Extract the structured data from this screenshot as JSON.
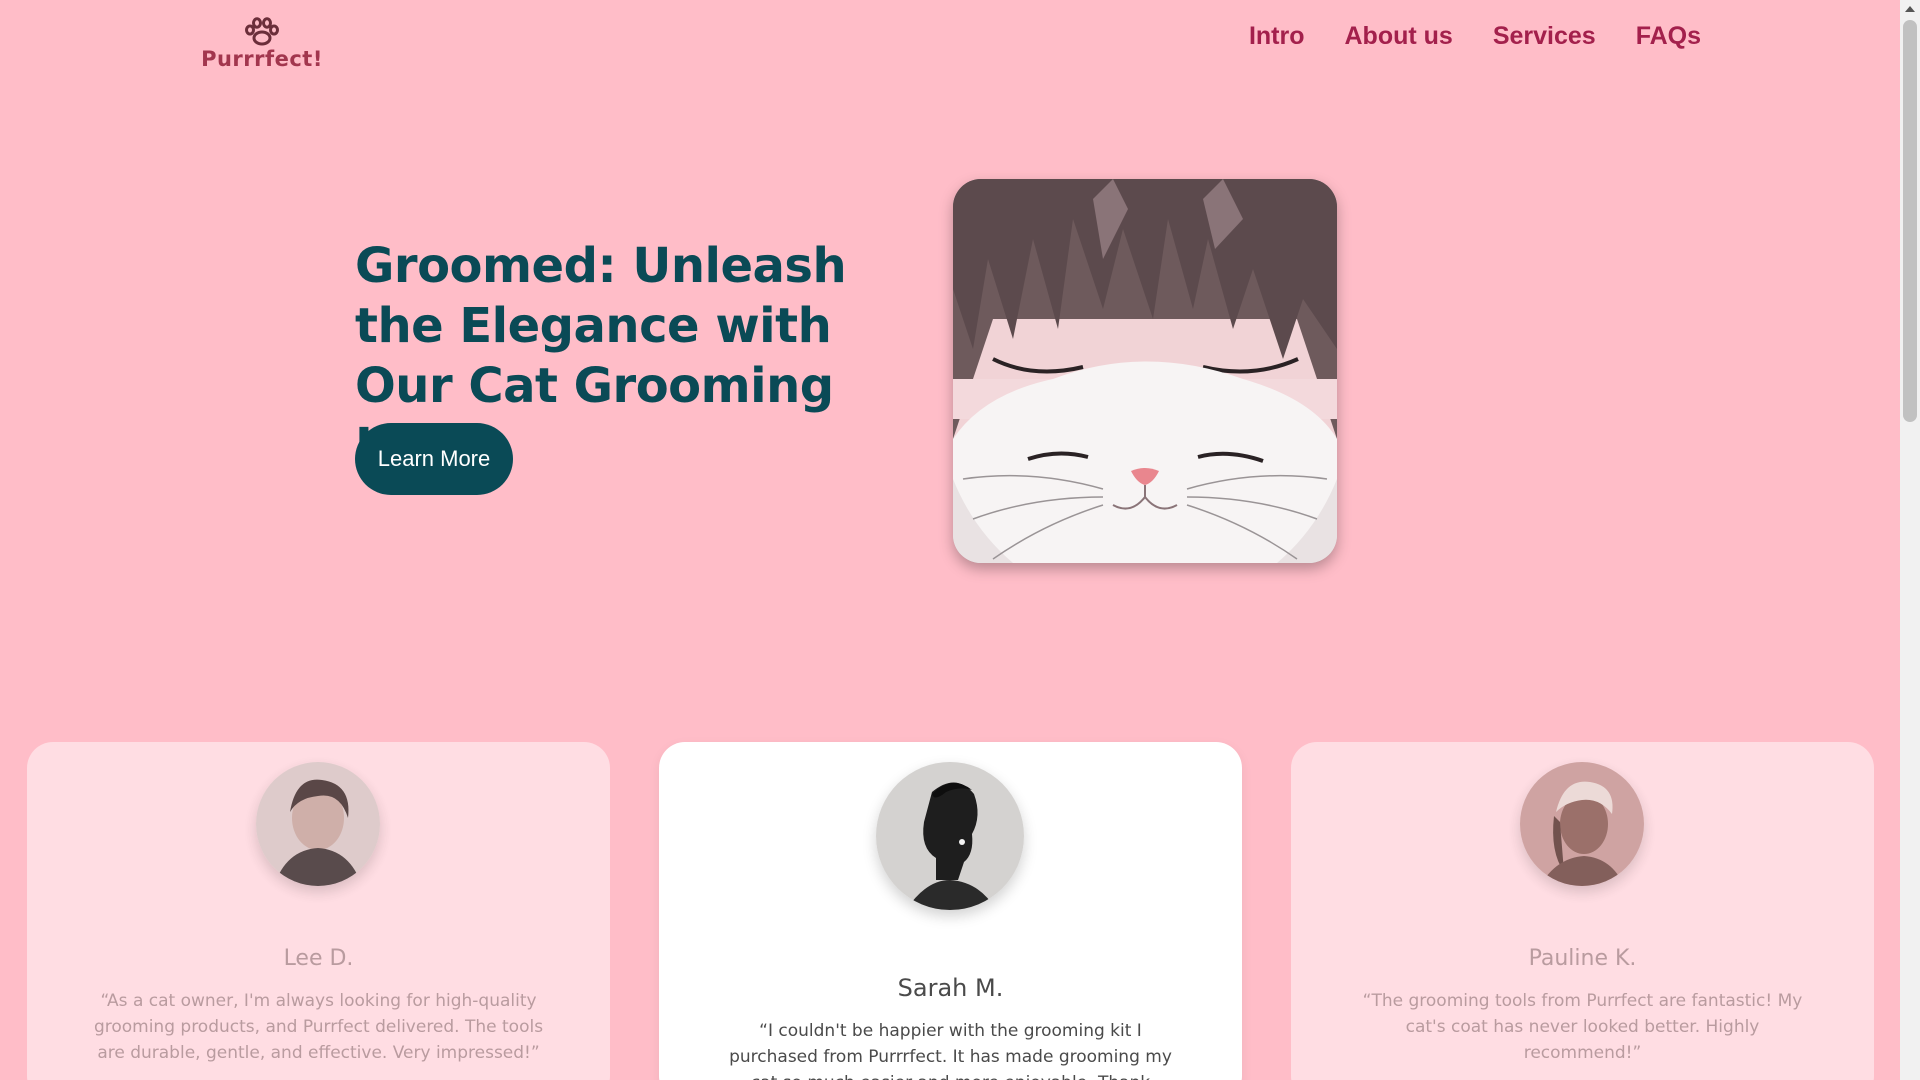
{
  "header": {
    "logo_text": "Purrrfect!",
    "logo_icon": "paw-icon",
    "nav": [
      {
        "label": "Intro"
      },
      {
        "label": "About us"
      },
      {
        "label": "Services"
      },
      {
        "label": "FAQs"
      }
    ]
  },
  "hero": {
    "title": "Groomed: Unleash the Elegance with Our Cat Grooming Kits!",
    "button_label": "Learn More",
    "image": "anime-girl-cat-illustration"
  },
  "testimonials": [
    {
      "name": "Lee D.",
      "quote": "“As a cat owner, I'm always looking for high-quality grooming products, and Purrfect delivered. The tools are durable, gentle, and effective. Very impressed!”",
      "state": "inactive"
    },
    {
      "name": "Sarah M.",
      "quote": "“I couldn't be happier with the grooming kit I purchased from Purrrfect. It has made grooming my cat so much easier and more enjoyable. Thank you!”",
      "state": "active"
    },
    {
      "name": "Pauline K.",
      "quote": "“The grooming tools from Purrfect are fantastic! My cat's coat has never looked better. Highly recommend!”",
      "state": "inactive"
    }
  ],
  "colors": {
    "background": "#FFBDC8",
    "accent": "#0A4A56",
    "nav": "#A3204C",
    "card_inactive": "#FFDDE3",
    "card_active": "#FFFFFF"
  }
}
